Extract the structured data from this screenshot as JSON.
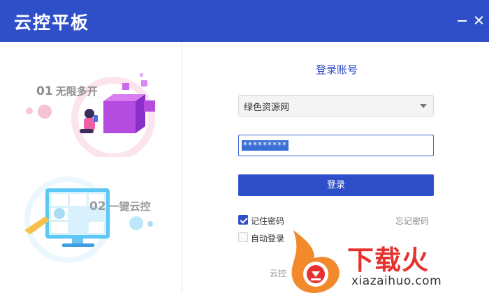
{
  "window": {
    "title": "云控平板",
    "minimize_icon": "minimize-icon",
    "close_icon": "close-icon"
  },
  "features": [
    {
      "num": "01",
      "label": "无限多开"
    },
    {
      "num": "02",
      "label": "一键云控"
    }
  ],
  "login": {
    "title": "登录账号",
    "account": {
      "value": "绿色资源网",
      "icon": "chevron-down-icon"
    },
    "password": {
      "value": "*********"
    },
    "submit_label": "登录",
    "remember": {
      "label": "记住密码",
      "checked": true
    },
    "auto_login": {
      "label": "自动登录",
      "checked": false
    },
    "forgot_label": "忘记密码",
    "footer": "云控"
  },
  "watermark": {
    "name": "下载火",
    "url": "xiazaihuo.com"
  },
  "colors": {
    "brand": "#2f4fc9",
    "illustration_pink": "#f06ab8",
    "illustration_purple": "#9b3fe0",
    "illustration_blue": "#5cc8f5",
    "watermark_red": "#e5322e"
  }
}
